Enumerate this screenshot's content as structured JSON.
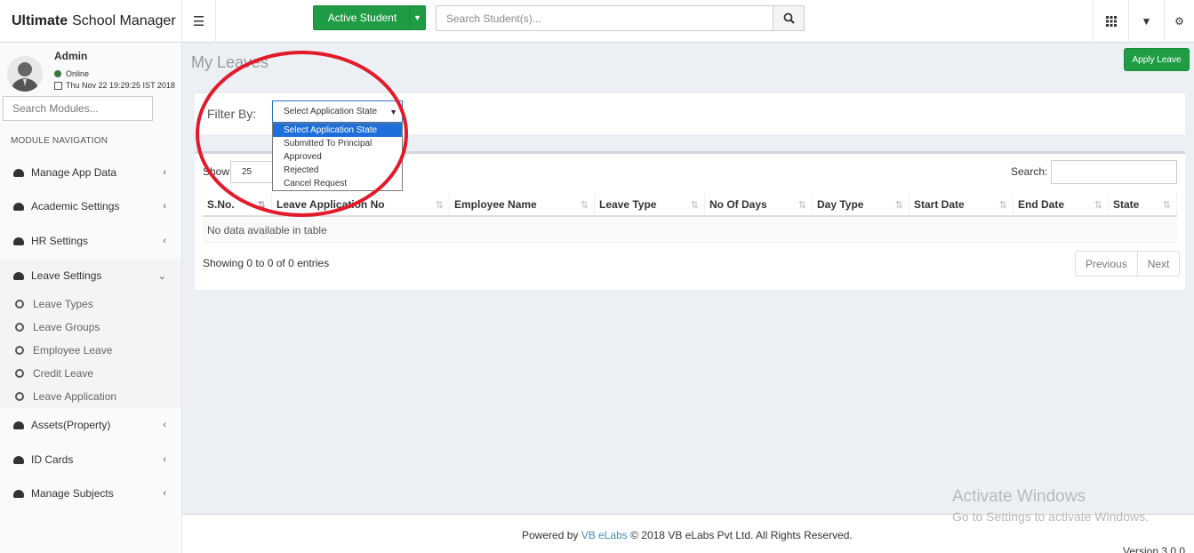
{
  "header": {
    "app_name_bold": "Ultimate",
    "app_name_rest": "School Manager",
    "menu_icon": "hamburger-icon",
    "active_student_label": "Active Student",
    "search_placeholder": "Search Student(s)...",
    "search_icon": "search-icon",
    "apps_icon": "grid-icon",
    "dropdown_icon": "caret-down-icon",
    "settings_icon": "gears-icon"
  },
  "sidebar": {
    "user_name": "Admin",
    "status": "Online",
    "datetime": "Thu Nov 22 19:29:25 IST 2018",
    "module_search_placeholder": "Search Modules...",
    "nav_header": "MODULE NAVIGATION",
    "items": [
      {
        "label": "Manage App Data"
      },
      {
        "label": "Academic Settings"
      },
      {
        "label": "HR Settings"
      },
      {
        "label": "Leave Settings"
      },
      {
        "label": "Assets(Property)"
      },
      {
        "label": "ID Cards"
      },
      {
        "label": "Manage Subjects"
      }
    ],
    "leave_sub_items": [
      {
        "label": "Leave Types"
      },
      {
        "label": "Leave Groups"
      },
      {
        "label": "Employee Leave"
      },
      {
        "label": "Credit Leave"
      },
      {
        "label": "Leave Application"
      }
    ]
  },
  "main": {
    "page_title": "My Leaves",
    "apply_button": "Apply Leave",
    "filter_label": "Filter By:",
    "filter_selected": "Select Application State",
    "filter_options": [
      "Select Application State",
      "Submitted To Principal",
      "Approved",
      "Rejected",
      "Cancel Request"
    ],
    "show_label": "Show",
    "page_length": "25",
    "search_label": "Search:",
    "columns": [
      "S.No.",
      "Leave Application No",
      "Employee Name",
      "Leave Type",
      "No Of Days",
      "Day Type",
      "Start Date",
      "End Date",
      "State"
    ],
    "empty_message": "No data available in table",
    "info": "Showing 0 to 0 of 0 entries",
    "prev_label": "Previous",
    "next_label": "Next"
  },
  "footer": {
    "powered_by": "Powered by",
    "company_link": "VB eLabs",
    "copyright": "© 2018 VB eLabs Pvt Ltd. All Rights Reserved.",
    "version": "Version 3.0.0"
  },
  "watermark": {
    "line1": "Activate Windows",
    "line2": "Go to Settings to activate Windows."
  },
  "colors": {
    "primary_green": "#1f9d45",
    "annotation_red": "#e21a2a",
    "select_highlight": "#1e6fd9"
  }
}
